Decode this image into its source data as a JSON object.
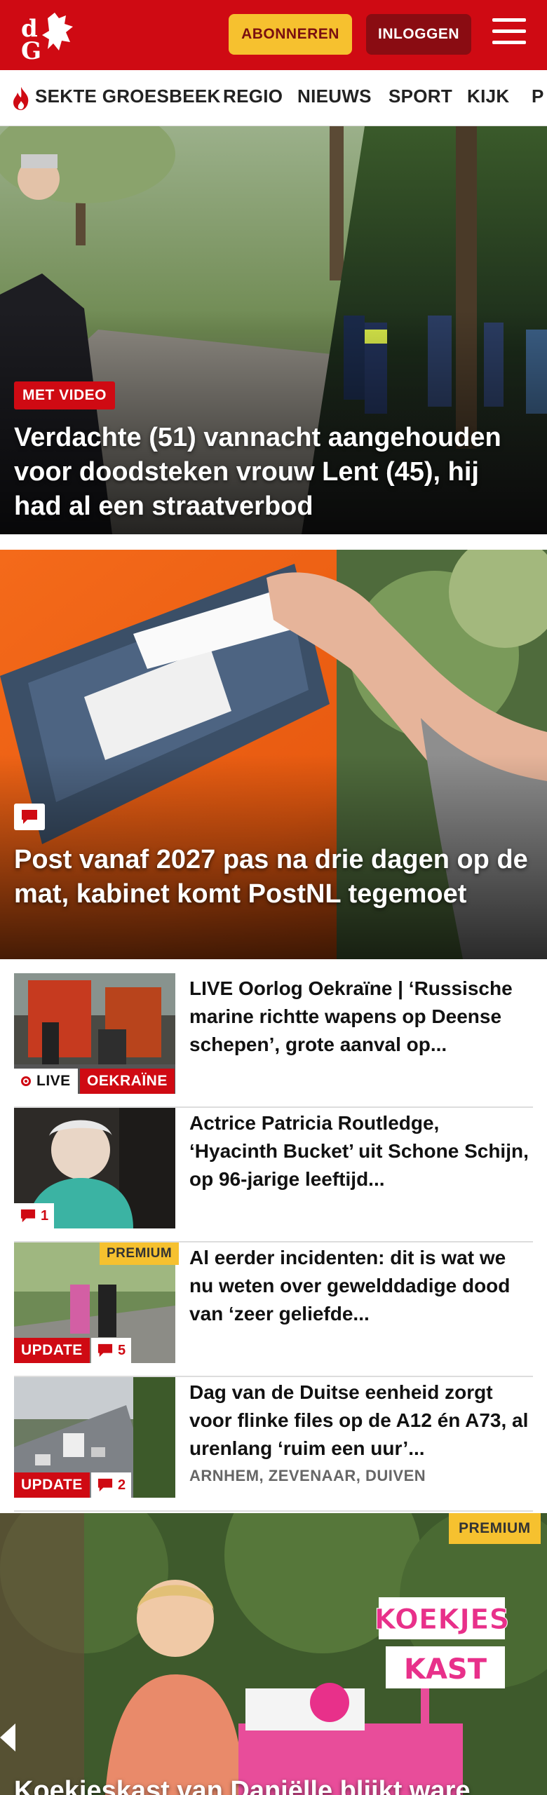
{
  "header": {
    "subscribe_label": "ABONNEREN",
    "login_label": "INLOGGEN"
  },
  "nav": {
    "items": [
      "SEKTE GROESBEEK",
      "REGIO",
      "NIEUWS",
      "SPORT",
      "KIJK",
      "P"
    ]
  },
  "hero1": {
    "badge": "MET VIDEO",
    "title": "Verdachte (51) vannacht aangehouden voor doodsteken vrouw Lent (45), hij had al een straatverbod"
  },
  "hero2": {
    "title": "Post vanaf 2027 pas na drie dagen op de mat, kabinet komt PostNL tegemoet"
  },
  "articles": [
    {
      "title": "LIVE Oorlog Oekraïne | ‘Russische marine richtte wapens op Deense schepen’, grote aanval op...",
      "live_label": "LIVE",
      "tag": "OEKRAÏNE"
    },
    {
      "title": "Actrice Patricia Routledge, ‘Hyacinth Bucket’ uit Schone Schijn, op 96-jarige leeftijd...",
      "comments": "1"
    },
    {
      "title": "Al eerder incidenten: dit is wat we nu weten over gewelddadige dood van ‘zeer geliefde...",
      "premium": "PREMIUM",
      "tag": "UPDATE",
      "comments": "5"
    },
    {
      "title": "Dag van de Duitse eenheid zorgt voor flinke files op de A12 én A73, al urenlang ‘ruim een uur’...",
      "subtitle": "ARNHEM, ZEVENAAR, DUIVEN",
      "tag": "UPDATE",
      "comments": "2"
    }
  ],
  "hero3": {
    "premium": "PREMIUM",
    "sign_text_1": "KOEKJES",
    "sign_text_2": "KAST",
    "title": "Koekjeskast van Daniëlle blijkt ware"
  },
  "colors": {
    "brand_red": "#cf0a13",
    "premium_yellow": "#f6c12f"
  }
}
